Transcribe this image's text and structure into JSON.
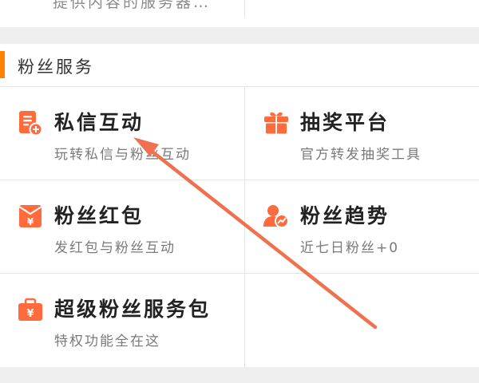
{
  "top_card": {
    "partial_text": "提供内容的服务器…"
  },
  "section": {
    "title": "粉丝服务",
    "accent_color": "#ff8200"
  },
  "icon_color": "#ff6b3d",
  "arrow_color": "#f0714f",
  "tiles": [
    {
      "title": "私信互动",
      "subtitle": "玩转私信与粉丝互动",
      "icon": "message-doc-icon"
    },
    {
      "title": "抽奖平台",
      "subtitle": "官方转发抽奖工具",
      "icon": "gift-box-icon"
    },
    {
      "title": "粉丝红包",
      "subtitle": "发红包与粉丝互动",
      "icon": "red-envelope-icon"
    },
    {
      "title": "粉丝趋势",
      "subtitle": "近七日粉丝+0",
      "icon": "fan-trend-icon"
    },
    {
      "title": "超级粉丝服务包",
      "subtitle": "特权功能全在这",
      "icon": "service-briefcase-icon"
    }
  ]
}
